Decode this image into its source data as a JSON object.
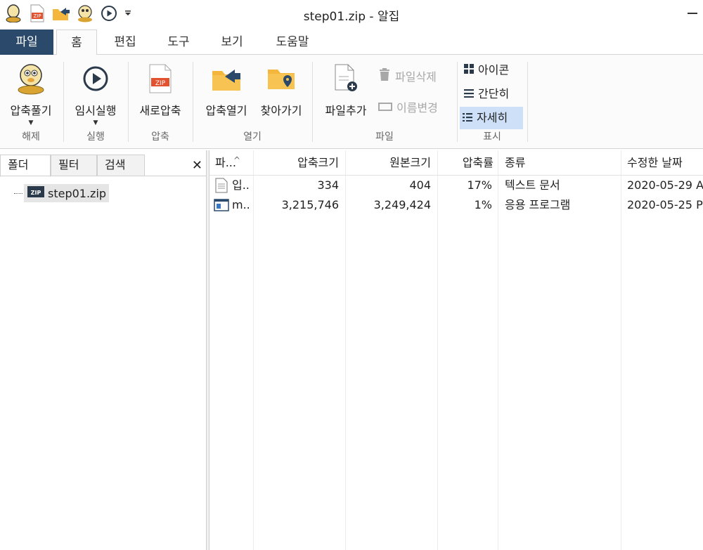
{
  "window": {
    "title": "step01.zip - 알집"
  },
  "qat": {
    "icons": [
      "alzip-mascot-icon",
      "zip-file-icon",
      "folder-open-icon",
      "extract-mascot-icon",
      "play-icon",
      "customize-dropdown-icon"
    ]
  },
  "tabs": [
    {
      "label": "파일"
    },
    {
      "label": "홈"
    },
    {
      "label": "편집"
    },
    {
      "label": "도구"
    },
    {
      "label": "보기"
    },
    {
      "label": "도움말"
    }
  ],
  "ribbon": {
    "groups": {
      "extract": "해제",
      "run": "실행",
      "compress": "압축",
      "open": "열기",
      "file": "파일",
      "view": "표시"
    },
    "buttons": {
      "extract": "압축풀기",
      "temp_run": "임시실행",
      "new_zip": "새로압축",
      "open_zip": "압축열기",
      "goto": "찾아가기",
      "add_file": "파일추가",
      "delete_file": "파일삭제",
      "rename": "이름변경",
      "icons": "아이콘",
      "simple": "간단히",
      "detail": "자세히"
    }
  },
  "leftpanel": {
    "tabs": [
      "폴더",
      "필터",
      "검색"
    ],
    "close": "✕",
    "tree": [
      {
        "label": "step01.zip"
      }
    ]
  },
  "filelist": {
    "columns": [
      "파...",
      "압축크기",
      "원본크기",
      "압축률",
      "종류",
      "수정한 날짜"
    ],
    "sort_indicator": "^",
    "rows": [
      {
        "name": "입..",
        "packed": "334",
        "original": "404",
        "ratio": "17%",
        "type": "텍스트 문서",
        "date": "2020-05-29 A",
        "icon": "text-document-icon"
      },
      {
        "name": "m..",
        "packed": "3,215,746",
        "original": "3,249,424",
        "ratio": "1%",
        "type": "응용 프로그램",
        "date": "2020-05-25 P",
        "icon": "application-icon"
      }
    ]
  },
  "colors": {
    "file_tab": "#2b4a6b",
    "selected": "#cde0f7",
    "accent_orange": "#f0a020",
    "zip_red": "#e2522e"
  }
}
